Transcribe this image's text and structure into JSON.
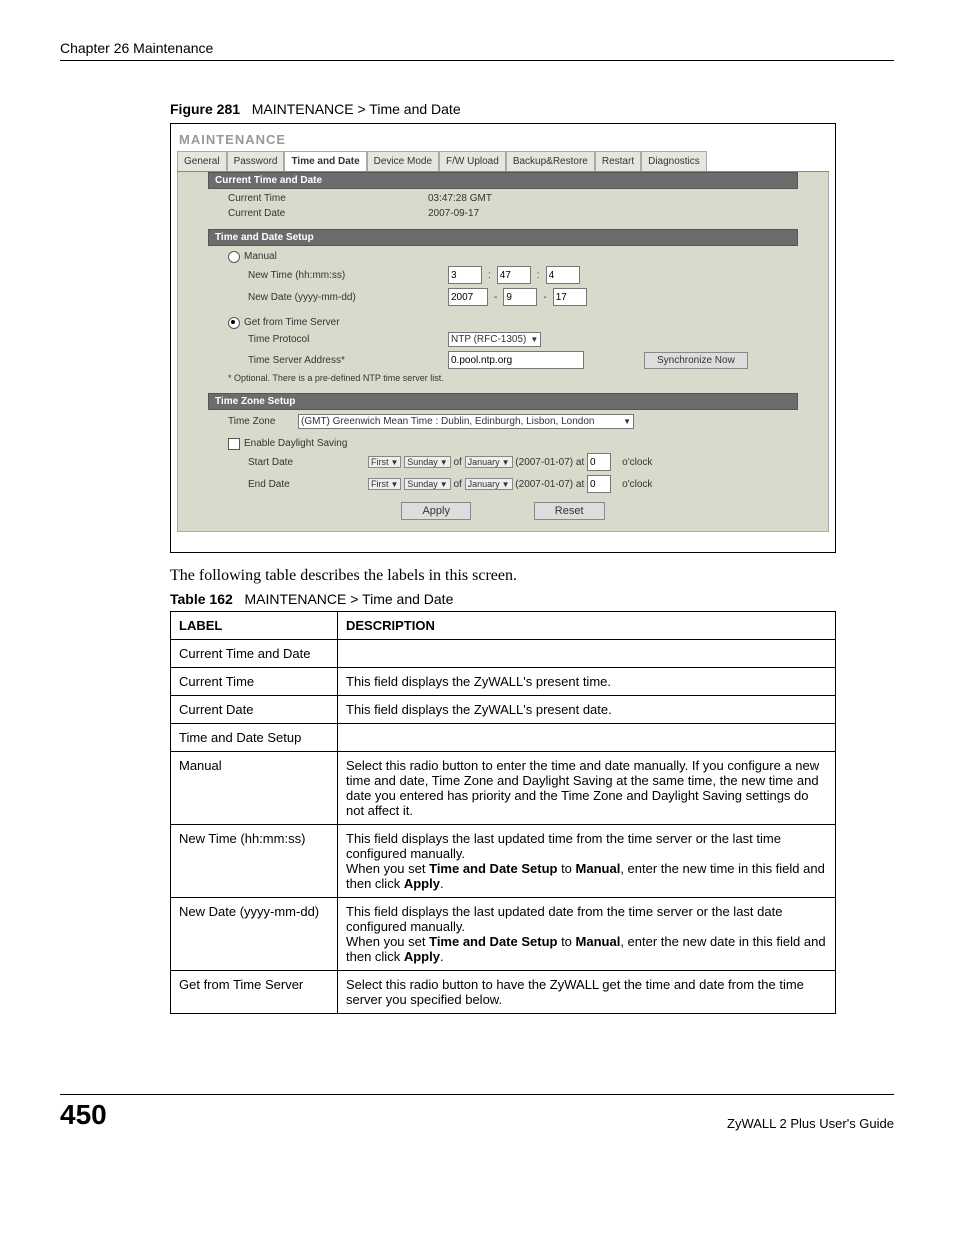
{
  "header": {
    "chapter": "Chapter 26 Maintenance"
  },
  "figure": {
    "label": "Figure 281",
    "title": "MAINTENANCE > Time and Date"
  },
  "screenshot": {
    "title": "MAINTENANCE",
    "tabs": {
      "general": "General",
      "password": "Password",
      "time_and_date": "Time and Date",
      "device_mode": "Device Mode",
      "fw_upload": "F/W Upload",
      "backup_restore": "Backup&Restore",
      "restart": "Restart",
      "diagnostics": "Diagnostics"
    },
    "section1": {
      "heading": "Current Time and Date",
      "current_time_label": "Current Time",
      "current_time_value": "03:47:28 GMT",
      "current_date_label": "Current Date",
      "current_date_value": "2007-09-17"
    },
    "section2": {
      "heading": "Time and Date Setup",
      "manual_label": "Manual",
      "new_time_label": "New Time (hh:mm:ss)",
      "new_time_hh": "3",
      "new_time_mm": "47",
      "new_time_ss": "4",
      "new_date_label": "New Date (yyyy-mm-dd)",
      "new_date_yyyy": "2007",
      "new_date_mm": "9",
      "new_date_dd": "17",
      "get_from_server_label": "Get from Time Server",
      "time_protocol_label": "Time Protocol",
      "time_protocol_value": "NTP (RFC-1305)",
      "time_server_label": "Time Server Address*",
      "time_server_value": "0.pool.ntp.org",
      "sync_btn": "Synchronize Now",
      "footnote": "* Optional. There is a pre-defined NTP time server list."
    },
    "section3": {
      "heading": "Time Zone Setup",
      "time_zone_label": "Time Zone",
      "time_zone_value": "(GMT) Greenwich Mean Time : Dublin, Edinburgh, Lisbon, London",
      "enable_daylight": "Enable Daylight Saving",
      "start_date_label": "Start Date",
      "end_date_label": "End Date",
      "ordinal": "First",
      "weekday": "Sunday",
      "of": "of",
      "month": "January",
      "date_paren": "(2007-01-07)",
      "at": "at",
      "hour": "0",
      "oclock": "o'clock"
    },
    "buttons": {
      "apply": "Apply",
      "reset": "Reset"
    }
  },
  "paragraph": "The following table describes the labels in this screen.",
  "table_caption": {
    "label": "Table 162",
    "title": "MAINTENANCE > Time and Date"
  },
  "table": {
    "headers": {
      "label": "LABEL",
      "description": "DESCRIPTION"
    },
    "rows": [
      {
        "label": "Current Time and Date",
        "description": ""
      },
      {
        "label": "Current Time",
        "description": "This field displays the ZyWALL's present time."
      },
      {
        "label": "Current Date",
        "description": "This field displays the ZyWALL's present date."
      },
      {
        "label": "Time and Date Setup",
        "description": ""
      },
      {
        "label": "Manual",
        "description": "Select this radio button to enter the time and date manually. If you configure a new time and date, Time Zone and Daylight Saving at the same time, the new time and date you entered has priority and the Time Zone and Daylight Saving settings do not affect it."
      },
      {
        "label": "New Time (hh:mm:ss)",
        "description_parts": {
          "p1": "This field displays the last updated time from the time server or the last time configured manually.",
          "p2a": "When you set ",
          "p2b": "Time and Date Setup",
          "p2c": " to ",
          "p2d": "Manual",
          "p2e": ", enter the new time in this field and then click ",
          "p2f": "Apply",
          "p2g": "."
        }
      },
      {
        "label": "New Date (yyyy-mm-dd)",
        "description_parts": {
          "p1": "This field displays the last updated date from the time server or the last date configured manually.",
          "p2a": "When you set ",
          "p2b": "Time and Date Setup",
          "p2c": " to ",
          "p2d": "Manual",
          "p2e": ", enter the new date in this field and then click ",
          "p2f": "Apply",
          "p2g": "."
        }
      },
      {
        "label": "Get from Time Server",
        "description": "Select this radio button to have the ZyWALL get the time and date from the time server you specified below."
      }
    ]
  },
  "footer": {
    "page": "450",
    "guide": "ZyWALL 2 Plus User's Guide"
  }
}
